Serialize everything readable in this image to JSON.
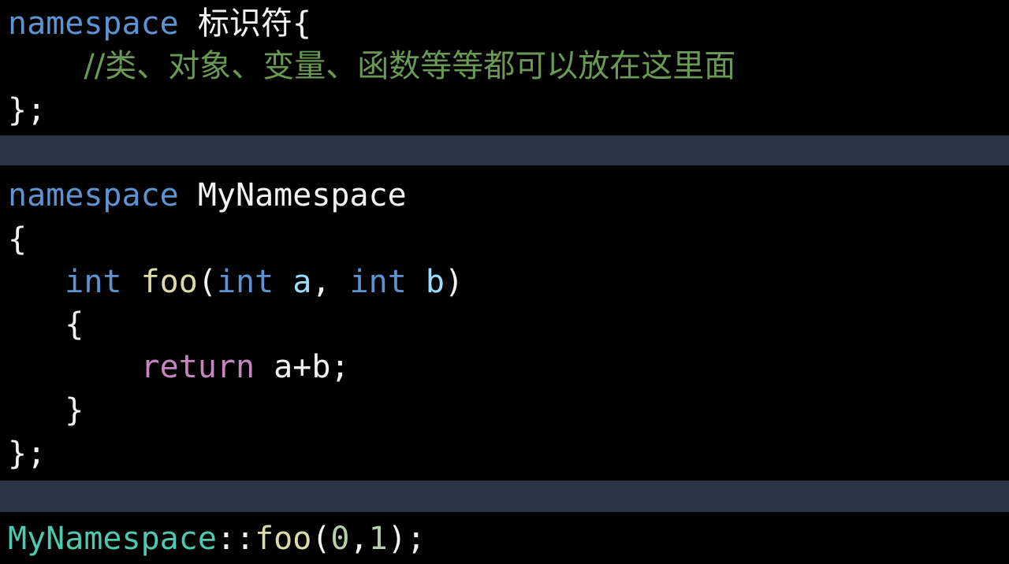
{
  "block1": {
    "line1": {
      "keyword": "namespace",
      "identifier": "标识符",
      "brace": "{"
    },
    "line2": {
      "indent": "    ",
      "comment": "//类、对象、变量、函数等等都可以放在这里面"
    },
    "line3": {
      "text": "};"
    }
  },
  "block2": {
    "line1": {
      "keyword": "namespace",
      "name": "MyNamespace"
    },
    "line2": {
      "text": "{"
    },
    "line3": {
      "indent": "   ",
      "type1": "int",
      "func": "foo",
      "paren_open": "(",
      "type2": "int",
      "param1": "a",
      "comma": ",",
      "type3": "int",
      "param2": "b",
      "paren_close": ")"
    },
    "line4": {
      "indent": "   ",
      "text": "{"
    },
    "line5": {
      "indent": "       ",
      "keyword": "return",
      "expr": "a+b;"
    },
    "line6": {
      "indent": "   ",
      "text": "}"
    },
    "line7": {
      "text": "};"
    }
  },
  "block3": {
    "line1": {
      "ns": "MyNamespace",
      "scope": "::",
      "func": "foo",
      "paren_open": "(",
      "arg1": "0",
      "comma": ",",
      "arg2": "1",
      "tail": ");"
    }
  },
  "colors": {
    "background": "#000000",
    "divider": "#2a3645",
    "keyword": "#5e93d1",
    "control_keyword": "#c586c0",
    "function": "#dcdcaa",
    "variable": "#9cdcfe",
    "comment": "#6a9955",
    "namespace": "#4ec9b0",
    "number": "#b5cea8",
    "text": "#f2f2f2"
  }
}
